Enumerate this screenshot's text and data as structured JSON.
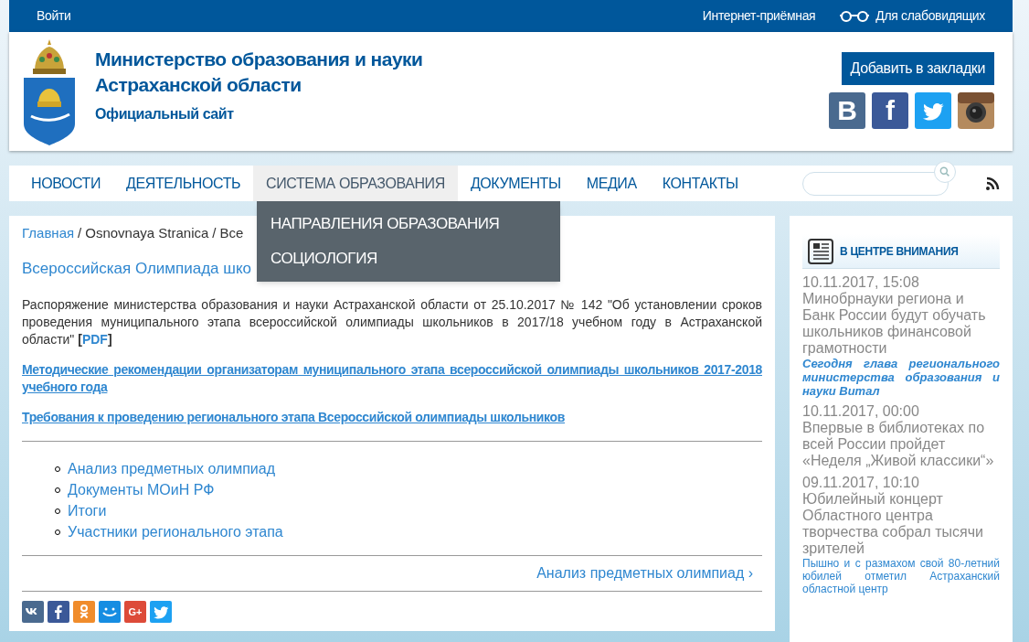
{
  "top_bar": {
    "login": "Войти",
    "reception": "Интернет-приёмная",
    "low_vision": "Для слабовидящих"
  },
  "header": {
    "title_lines": [
      "Министерство образования и науки",
      "Астраханской области"
    ],
    "subtitle": "Официальный сайт",
    "bookmark_button": "Добавить в закладки",
    "social": [
      {
        "kind": "vk",
        "glyph": "B"
      },
      {
        "kind": "facebook",
        "glyph": "f"
      },
      {
        "kind": "twitter"
      },
      {
        "kind": "instagram"
      }
    ]
  },
  "nav": {
    "items": [
      {
        "label": "НОВОСТИ",
        "selected": false
      },
      {
        "label": "ДЕЯТЕЛЬНОСТЬ",
        "selected": false
      },
      {
        "label": "СИСТЕМА ОБРАЗОВАНИЯ",
        "selected": true
      },
      {
        "label": "ДОКУМЕНТЫ",
        "selected": false
      },
      {
        "label": "МЕДИА",
        "selected": false
      },
      {
        "label": "КОНТАКТЫ",
        "selected": false
      }
    ],
    "dropdown": [
      "НАПРАВЛЕНИЯ ОБРАЗОВАНИЯ",
      "СОЦИОЛОГИЯ"
    ]
  },
  "main": {
    "breadcrumb": [
      {
        "label": "Главная",
        "link": true
      },
      {
        "label": "Osnovnaya Stranica",
        "link": false
      },
      {
        "label": "Все",
        "link": false
      }
    ],
    "breadcrumb_separator": "/",
    "title": "Всероссийская Олимпиада шко",
    "paragraph": {
      "text": "Распоряжение министерства образования и науки Астраханской области от 25.10.2017 № 142 \"Об установлении сроков проведения муниципального этапа всероссийской олимпиады школьников в 2017/18 учебном году в Астраханской области\" ",
      "bracket_open": "[",
      "link": "PDF",
      "bracket_close": "]"
    },
    "links": [
      "Методические рекомендации организаторам муниципального этапа всероссийской олимпиады школьников 2017-2018 учебного года",
      "Требования к проведению регионального этапа Всероссийской олимпиады школьников"
    ],
    "list": [
      "Анализ предметных олимпиад",
      "Документы МОиН РФ",
      "Итоги",
      "Участники регионального этапа"
    ],
    "next_link": "Анализ предметных олимпиад ›",
    "share": [
      {
        "kind": "vk"
      },
      {
        "kind": "facebook"
      },
      {
        "kind": "odnoklassniki"
      },
      {
        "kind": "moimir"
      },
      {
        "kind": "googleplus",
        "glyph": "G+"
      },
      {
        "kind": "twitter"
      }
    ]
  },
  "sidebar": {
    "title": "В ЦЕНТРЕ ВНИМАНИЯ",
    "news": [
      {
        "date": "10.11.2017, 15:08",
        "title": "Минобрнауки региона и Банк России будут обучать школьников финансовой грамотности",
        "summary": "Сегодня глава регионального министерства образования и науки Витал",
        "emphasized": true
      },
      {
        "date": "10.11.2017, 00:00",
        "title": "Впервые в библиотеках по всей России пройдет «Неделя „Живой классики“»"
      },
      {
        "date": "09.11.2017, 10:10",
        "title": "Юбилейный концерт Областного центра творчества собрал тысячи зрителей",
        "summary": "Пышно и с размахом свой 80-летний юбилей отметил Астраханский областной центр",
        "emphasized": false
      }
    ]
  }
}
